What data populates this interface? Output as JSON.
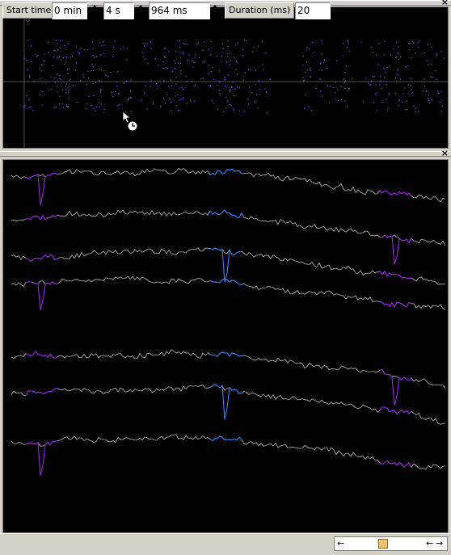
{
  "raster": {
    "zero_label": "0",
    "color": "#6060ff",
    "crosshair_color": "#555555"
  },
  "traces": {
    "base_color": "#b8b8b8",
    "spike_colors": [
      "#a020f0",
      "#3080ff",
      "#a020f0"
    ]
  },
  "toolbar": {
    "start_time_label": "Start time",
    "min_value": "0 min",
    "sec_value": "4 s",
    "ms_value": "964 ms",
    "duration_label": "Duration (ms)",
    "duration_value": "20"
  },
  "icons": {
    "close": "×",
    "left_arrow": "←",
    "right_arrow": "→"
  }
}
